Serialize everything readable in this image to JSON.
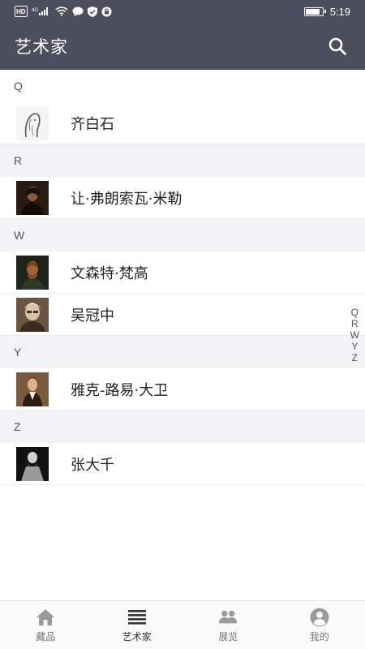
{
  "status_bar": {
    "hd": "HD",
    "network": "4G",
    "time": "5:19",
    "battery_level": 0.9
  },
  "header": {
    "title": "艺术家",
    "search_icon": "search-icon"
  },
  "sections": [
    {
      "letter": "Q",
      "artists": [
        {
          "name": "齐白石",
          "avatar_style": "sketch-light"
        }
      ]
    },
    {
      "letter": "R",
      "artists": [
        {
          "name": "让·弗朗索瓦·米勒",
          "avatar_style": "dark-portrait"
        }
      ]
    },
    {
      "letter": "W",
      "artists": [
        {
          "name": "文森特·梵高",
          "avatar_style": "dark-portrait"
        },
        {
          "name": "吴冠中",
          "avatar_style": "photo-warm"
        }
      ]
    },
    {
      "letter": "Y",
      "artists": [
        {
          "name": "雅克-路易·大卫",
          "avatar_style": "painting-warm"
        }
      ]
    },
    {
      "letter": "Z",
      "artists": [
        {
          "name": "张大千",
          "avatar_style": "bw-photo"
        }
      ]
    }
  ],
  "alpha_index": [
    "Q",
    "R",
    "W",
    "Y",
    "Z"
  ],
  "bottom_nav": [
    {
      "label": "藏品",
      "icon": "home-icon",
      "active": false
    },
    {
      "label": "艺术家",
      "icon": "list-icon",
      "active": true
    },
    {
      "label": "展览",
      "icon": "people-icon",
      "active": false
    },
    {
      "label": "我的",
      "icon": "user-icon",
      "active": false
    }
  ],
  "colors": {
    "header_bg": "#4b4e5c",
    "section_bg": "#f2f3f6",
    "nav_inactive": "#9a9a9a",
    "nav_active": "#333333"
  }
}
